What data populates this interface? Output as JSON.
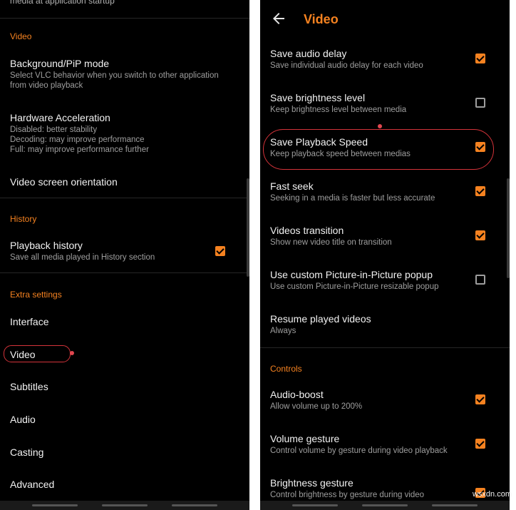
{
  "left": {
    "cut_text": "media at application startup",
    "sections": {
      "video": "Video",
      "history": "History",
      "extra": "Extra settings"
    },
    "bg_pip": {
      "title": "Background/PiP mode",
      "sub1": "Select VLC behavior when you switch to other application",
      "sub2": "from video playback"
    },
    "hw_accel": {
      "title": "Hardware Acceleration",
      "sub1": "Disabled: better stability",
      "sub2": "Decoding: may improve performance",
      "sub3": "Full: may improve performance further"
    },
    "orientation": {
      "title": "Video screen orientation"
    },
    "playback_history": {
      "title": "Playback history",
      "sub": "Save all media played in History section",
      "checked": true
    },
    "extra_items": [
      "Interface",
      "Video",
      "Subtitles",
      "Audio",
      "Casting",
      "Advanced"
    ]
  },
  "right": {
    "app_title": "Video",
    "back_icon": "arrow-left-icon",
    "items": [
      {
        "title": "Save audio delay",
        "sub": "Save individual audio delay for each video",
        "checked": true
      },
      {
        "title": "Save brightness level",
        "sub": "Keep brightness level between media",
        "checked": false
      },
      {
        "title": "Save Playback Speed",
        "sub": "Keep playback speed between medias",
        "checked": true
      },
      {
        "title": "Fast seek",
        "sub": "Seeking in a media is faster but less accurate",
        "checked": true
      },
      {
        "title": "Videos transition",
        "sub": "Show new video title on transition",
        "checked": true
      },
      {
        "title": "Use custom Picture-in-Picture popup",
        "sub": "Use custom Picture-in-Picture resizable popup",
        "checked": false
      },
      {
        "title": "Resume played videos",
        "sub": "Always"
      }
    ],
    "controls_section": "Controls",
    "controls": [
      {
        "title": "Audio-boost",
        "sub": "Allow volume up to 200%",
        "checked": true
      },
      {
        "title": "Volume gesture",
        "sub": "Control volume by gesture during video playback",
        "checked": true
      },
      {
        "title": "Brightness gesture",
        "sub": "Control brightness by gesture during video",
        "checked": true
      }
    ]
  },
  "colors": {
    "accent": "#f58220",
    "highlight": "#d4333a",
    "background": "#000000"
  },
  "watermark": "wsxdn.com"
}
